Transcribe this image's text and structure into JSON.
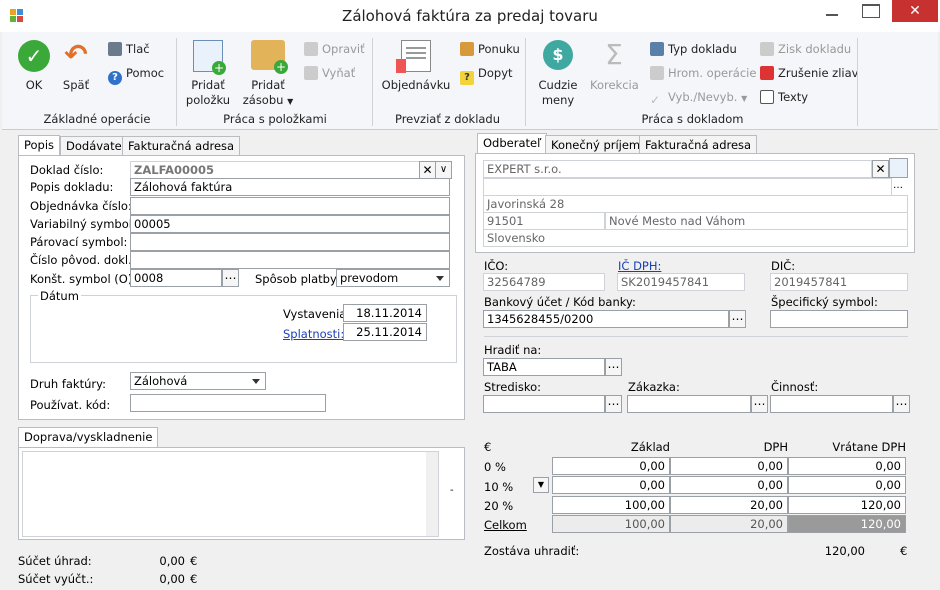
{
  "window": {
    "title": "Zálohová faktúra za predaj tovaru",
    "close": "✕"
  },
  "ribbon": {
    "ok": "OK",
    "back": "Späť",
    "print": "Tlač",
    "help": "Pomoc",
    "group_basic": "Základné operácie",
    "add_item_1": "Pridať",
    "add_item_2": "položku",
    "add_stock_1": "Pridať",
    "add_stock_2": "zásobu",
    "edit": "Opraviť",
    "cut": "Vyňať",
    "group_items": "Práca s položkami",
    "order": "Objednávku",
    "offer": "Ponuku",
    "note": "Dopyt",
    "group_take": "Prevziať z dokladu",
    "currency_1": "Cudzie",
    "currency_2": "meny",
    "correction": "Korekcia",
    "doc_type": "Typ dokladu",
    "bulk_ops": "Hrom. operácie",
    "select": "Vyb./Nevyb.",
    "profit": "Zisk dokladu",
    "cancel_disc": "Zrušenie zliav",
    "texts": "Texty",
    "group_doc": "Práca s dokladom"
  },
  "left": {
    "tabs": [
      "Popis",
      "Dodávateľ",
      "Fakturačná adresa"
    ],
    "doc_no_label": "Doklad číslo:",
    "doc_no": "ZALFA00005",
    "desc_label": "Popis dokladu:",
    "desc": "Zálohová faktúra",
    "order_no_label": "Objednávka číslo:",
    "order_no": "",
    "var_sym_label": "Variabilný symbol:",
    "var_sym": "00005",
    "pair_sym_label": "Párovací symbol:",
    "pair_sym": "",
    "orig_doc_label": "Číslo pôvod. dokl.:",
    "orig_doc": "",
    "const_sym_label": "Konšt. symbol (O):",
    "const_sym": "0008",
    "payment_label": "Spôsob platby:",
    "payment": "prevodom",
    "date_group": "Dátum",
    "issued_label": "Vystavenia:",
    "issued": "18.11.2014",
    "due_label": "Splatnosti:",
    "due": "25.11.2014",
    "invoice_type_label": "Druh faktúry:",
    "invoice_type": "Zálohová",
    "user_code_label": "Používat. kód:",
    "user_code": ""
  },
  "shipping": {
    "tab": "Doprava/vyskladnenie"
  },
  "totals_left": {
    "paid_label": "Súčet úhrad:",
    "paid": "0,00",
    "paid_cur": "€",
    "settled_label": "Súčet vyúčt.:",
    "settled": "0,00",
    "settled_cur": "€"
  },
  "right": {
    "tabs": [
      "Odberateľ",
      "Konečný príjemca",
      "Fakturačná adresa"
    ],
    "company": "EXPERT s.r.o.",
    "street": "Javorinská 28",
    "zip": "91501",
    "city": "Nové Mesto nad Váhom",
    "country": "Slovensko",
    "ico_label": "IČO:",
    "ico": "32564789",
    "icdph_label": "IČ DPH:",
    "icdph": "SK2019457841",
    "dic_label": "DIČ:",
    "dic": "2019457841",
    "bank_label": "Bankový účet / Kód banky:",
    "bank": "1345628455/0200",
    "spec_sym_label": "Špecifický symbol:",
    "spec_sym": "",
    "pay_by_label": "Hradiť na:",
    "pay_by": "TABA",
    "center_label": "Stredisko:",
    "order_label": "Zákazka:",
    "activity_label": "Činnosť:"
  },
  "vat": {
    "currency": "€",
    "headers": [
      "Základ",
      "DPH",
      "Vrátane DPH"
    ],
    "rows": [
      {
        "rate": "0 %",
        "base": "0,00",
        "vat": "0,00",
        "total": "0,00"
      },
      {
        "rate": "10 %",
        "base": "0,00",
        "vat": "0,00",
        "total": "0,00"
      },
      {
        "rate": "20 %",
        "base": "100,00",
        "vat": "20,00",
        "total": "120,00"
      },
      {
        "rate": "Celkom",
        "base": "100,00",
        "vat": "20,00",
        "total": "120,00"
      }
    ],
    "remaining_label": "Zostáva uhradiť:",
    "remaining": "120,00",
    "remaining_cur": "€"
  },
  "colors": {
    "ok_green": "#3aa93a",
    "close_red": "#c7312f",
    "link_blue": "#1a3fb5"
  }
}
